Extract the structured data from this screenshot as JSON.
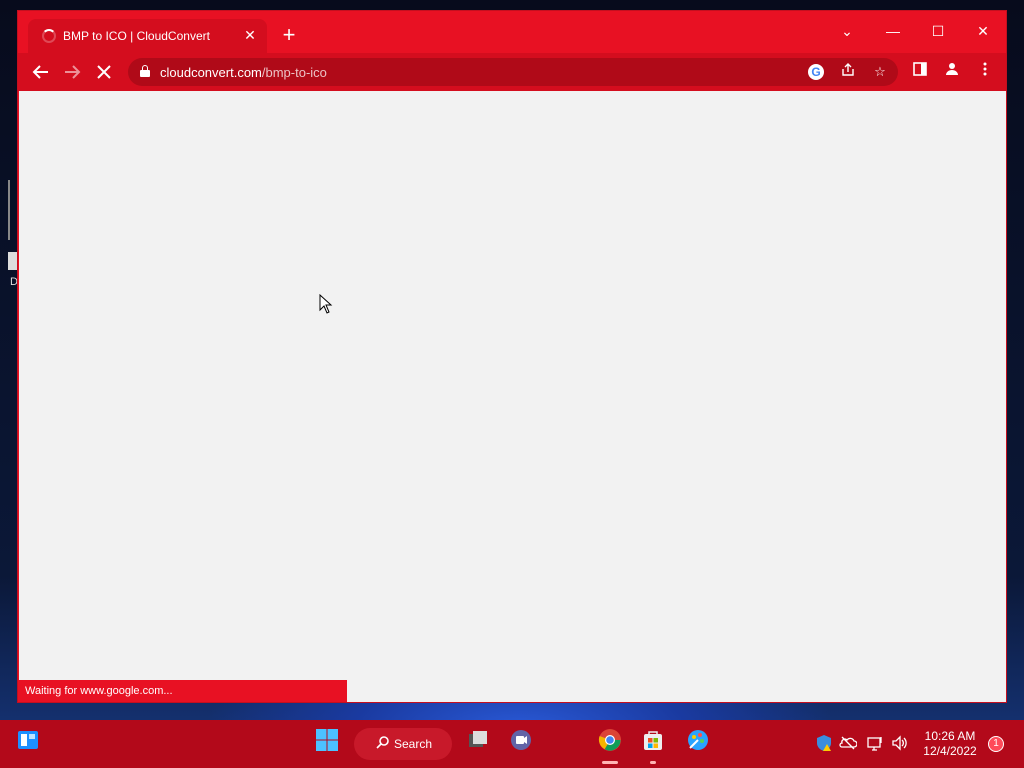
{
  "browser": {
    "tab_title": "BMP to ICO | CloudConvert",
    "tab_close": "✕",
    "new_tab": "+",
    "url_domain": "cloudconvert.com",
    "url_path": "/bmp-to-ico",
    "status_text": "Waiting for www.google.com...",
    "accent_color": "#e81123"
  },
  "window_controls": {
    "dropdown": "⌄",
    "minimize": "—",
    "maximize": "☐",
    "close": "✕"
  },
  "desktop": {
    "icon_label_fragment": "D"
  },
  "taskbar": {
    "search_label": "Search",
    "time": "10:26 AM",
    "date": "12/4/2022",
    "notification_count": "1",
    "apps": [
      "widgets",
      "start",
      "search",
      "task-view",
      "teams-chat",
      "chrome",
      "microsoft-store",
      "paint-3d"
    ]
  }
}
